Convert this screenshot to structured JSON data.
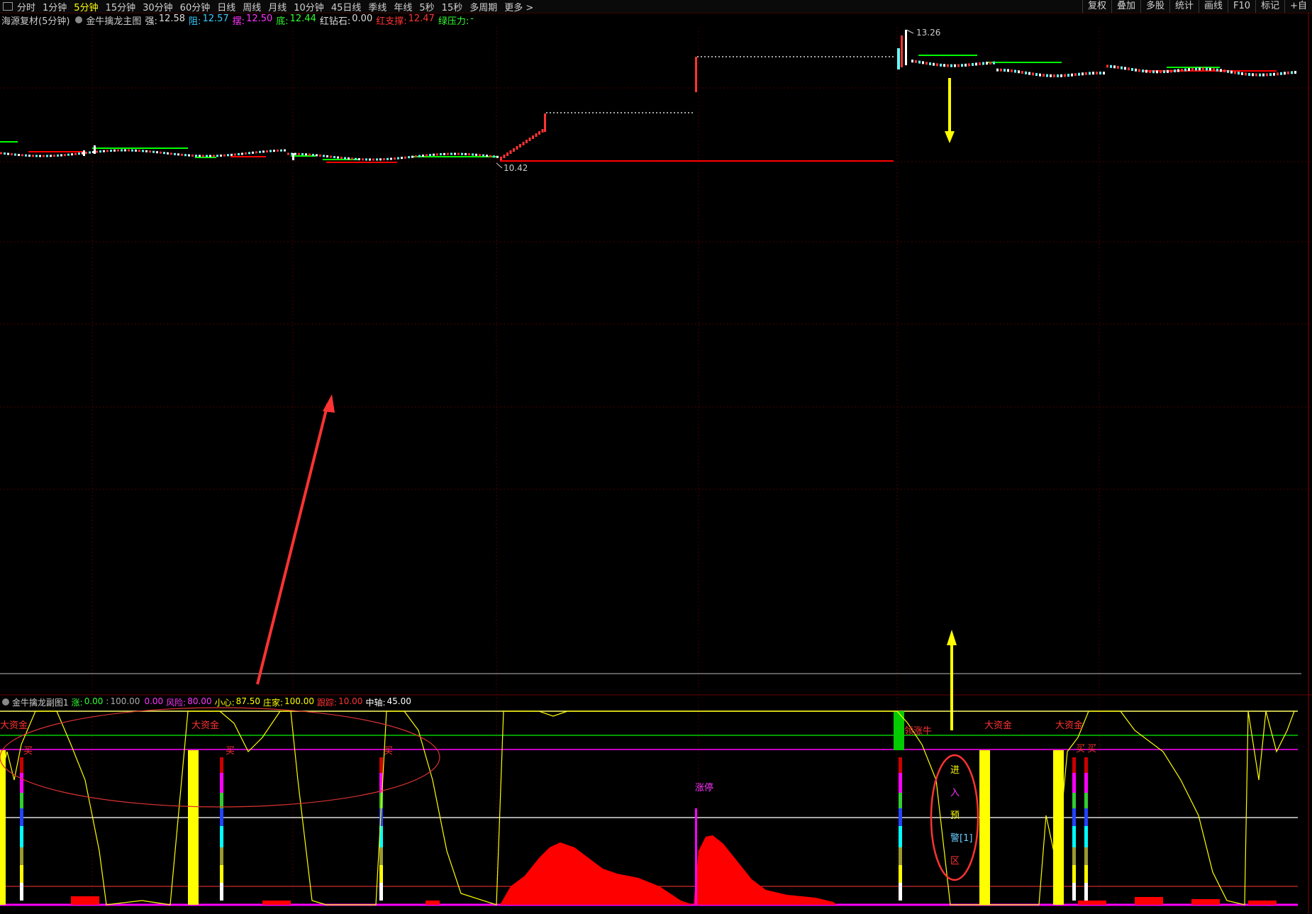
{
  "toolbar": {
    "periods": [
      "分时",
      "1分钟",
      "5分钟",
      "15分钟",
      "30分钟",
      "60分钟",
      "日线",
      "周线",
      "月线",
      "10分钟",
      "45日线",
      "季线",
      "年线",
      "5秒",
      "15秒",
      "多周期",
      "更多 >"
    ],
    "active_period": "5分钟",
    "right_buttons": [
      "复权",
      "叠加",
      "多股",
      "统计",
      "画线",
      "F10",
      "标记",
      "+自"
    ]
  },
  "main_panel": {
    "stock": "海源复材(5分钟)",
    "indicator": "金牛擒龙主图",
    "stats": [
      {
        "label": "强:",
        "value": "12.58",
        "color": "#dddddd"
      },
      {
        "label": "阻:",
        "value": "12.57",
        "color": "#33ccff"
      },
      {
        "label": "摆:",
        "value": "12.50",
        "color": "#ff33ff"
      },
      {
        "label": "底:",
        "value": "12.44",
        "color": "#33ff33"
      },
      {
        "label": "红钻石:",
        "value": "0.00",
        "color": "#dddddd"
      },
      {
        "label": "红支撑:",
        "value": "12.47",
        "color": "#ff3333"
      },
      {
        "label": "绿压力:",
        "value": "-",
        "color": "#33ff33"
      }
    ],
    "high_label": "13.26",
    "low_label": "10.42"
  },
  "sub_panel": {
    "indicator": "金牛擒龙副图1",
    "stats": [
      {
        "label": "涨:",
        "value": "0.00",
        "color": "#33ff33"
      },
      {
        "label": ":",
        "value": "100.00",
        "color": "#aaaaaa"
      },
      {
        "label": "",
        "value": "0.00",
        "color": "#ff33ff"
      },
      {
        "label": "风险:",
        "value": "80.00",
        "color": "#ff33ff"
      },
      {
        "label": "小心:",
        "value": "87.50",
        "color": "#ffff00"
      },
      {
        "label": "庄家:",
        "value": "100.00",
        "color": "#ffff00"
      },
      {
        "label": "跟踪:",
        "value": "10.00",
        "color": "#ff3333"
      },
      {
        "label": "中轴:",
        "value": "45.00",
        "color": "#ffffff"
      }
    ],
    "annotations": {
      "big_funds": "大资金",
      "buy": "买",
      "limit_up": "涨停",
      "lead_bull": "领涨牛",
      "warning_zone": [
        "进",
        "入",
        "预",
        "警[1]",
        "区"
      ]
    }
  },
  "colors": {
    "red": "#ff0000",
    "yellow": "#ffff00",
    "green": "#00ff00",
    "magenta": "#ff00ff",
    "grid": "#550000"
  }
}
